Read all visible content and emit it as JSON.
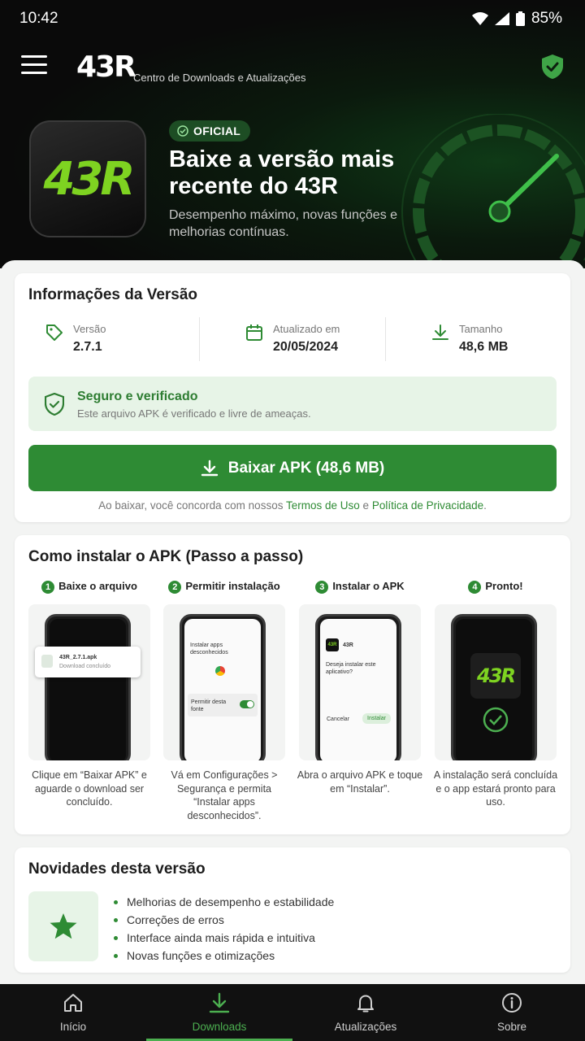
{
  "status": {
    "time": "10:42",
    "battery": "85%"
  },
  "header": {
    "logo": "43R",
    "subtitle": "Centro de Downloads e Atualizações"
  },
  "hero": {
    "badge": "OFICIAL",
    "title": "Baixe a versão mais recente do 43R",
    "description": "Desempenho máximo, novas funções e melhorias contínuas.",
    "app_logo": "43R"
  },
  "info": {
    "title": "Informações da Versão",
    "stats": [
      {
        "label": "Versão",
        "value": "2.7.1"
      },
      {
        "label": "Atualizado em",
        "value": "20/05/2024"
      },
      {
        "label": "Tamanho",
        "value": "48,6 MB"
      }
    ],
    "safe_title": "Seguro e verificado",
    "safe_desc": "Este arquivo APK é verificado e livre de ameaças.",
    "download_label": "Baixar APK (48,6 MB)",
    "terms_prefix": "Ao baixar, você concorda com nossos",
    "terms_link": "Termos de Uso",
    "terms_and": "e",
    "privacy_link": "Política de Privacidade",
    "terms_suffix": "."
  },
  "install": {
    "title": "Como instalar o APK (Passo a passo)",
    "steps": [
      {
        "num": "1",
        "title": "Baixe o arquivo",
        "caption": "Clique em “Baixar APK” e aguarde o download ser concluído."
      },
      {
        "num": "2",
        "title": "Permitir instalação",
        "caption": "Vá em Configurações > Segurança e permita “Instalar apps desconhecidos”."
      },
      {
        "num": "3",
        "title": "Instalar o APK",
        "caption": "Abra o arquivo APK e toque em “Instalar”."
      },
      {
        "num": "4",
        "title": "Pronto!",
        "caption": "A instalação será concluída e o app estará pronto para uso."
      }
    ],
    "mock": {
      "file_name": "43R_2.7.1.apk",
      "file_status": "Download concluído",
      "unknown_apps": "Instalar apps desconhecidos",
      "allow_source": "Permitir desta fonte",
      "app_name": "43R",
      "install_question": "Deseja instalar este aplicativo?",
      "cancel": "Cancelar",
      "install": "Instalar",
      "done_logo": "43R"
    }
  },
  "news": {
    "title": "Novidades desta versão",
    "items": [
      "Melhorias de desempenho e estabilidade",
      "Correções de erros",
      "Interface ainda mais rápida e intuitiva",
      "Novas funções e otimizações"
    ]
  },
  "nav": [
    {
      "label": "Início",
      "icon": "home-icon"
    },
    {
      "label": "Downloads",
      "icon": "download-icon",
      "active": true
    },
    {
      "label": "Atualizações",
      "icon": "bell-icon"
    },
    {
      "label": "Sobre",
      "icon": "info-icon"
    }
  ],
  "colors": {
    "accent": "#2e8b34",
    "brand_green": "#7ed321",
    "dark": "#0a0a0a"
  }
}
